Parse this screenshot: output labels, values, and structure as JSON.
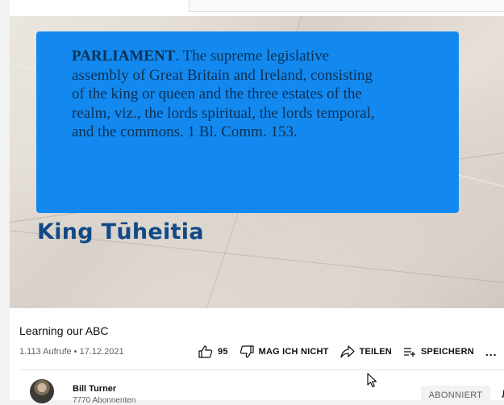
{
  "video": {
    "definition_term": "PARLIAMENT",
    "definition_text": ". The supreme legislative assembly of Great Britain and Ireland, consisting of the king or queen and the three estates of the realm, viz., the lords spiritual, the lords temporal, and the commons. 1 Bl. Comm. 153.",
    "overlay_title": "King Tūheitia"
  },
  "info": {
    "title": "Learning our ABC",
    "meta": "1.113 Aufrufe • 17.12.2021"
  },
  "actions": {
    "like_count": "95",
    "dislike_label": "MAG ICH NICHT",
    "share_label": "TEILEN",
    "save_label": "SPEICHERN",
    "more_label": "..."
  },
  "channel": {
    "name": "Bill Turner",
    "subscribers": "7770 Abonnenten",
    "subscribe_label": "ABONNIERT"
  },
  "icons": {
    "like": "thumbs-up-icon",
    "dislike": "thumbs-down-icon",
    "share": "share-arrow-icon",
    "save": "playlist-add-icon",
    "bell": "bell-icon",
    "cursor": "mouse-pointer-icon"
  },
  "colors": {
    "definition_box": "#1389f0",
    "definition_text": "#0c3154",
    "overlay_title": "#114a86"
  }
}
